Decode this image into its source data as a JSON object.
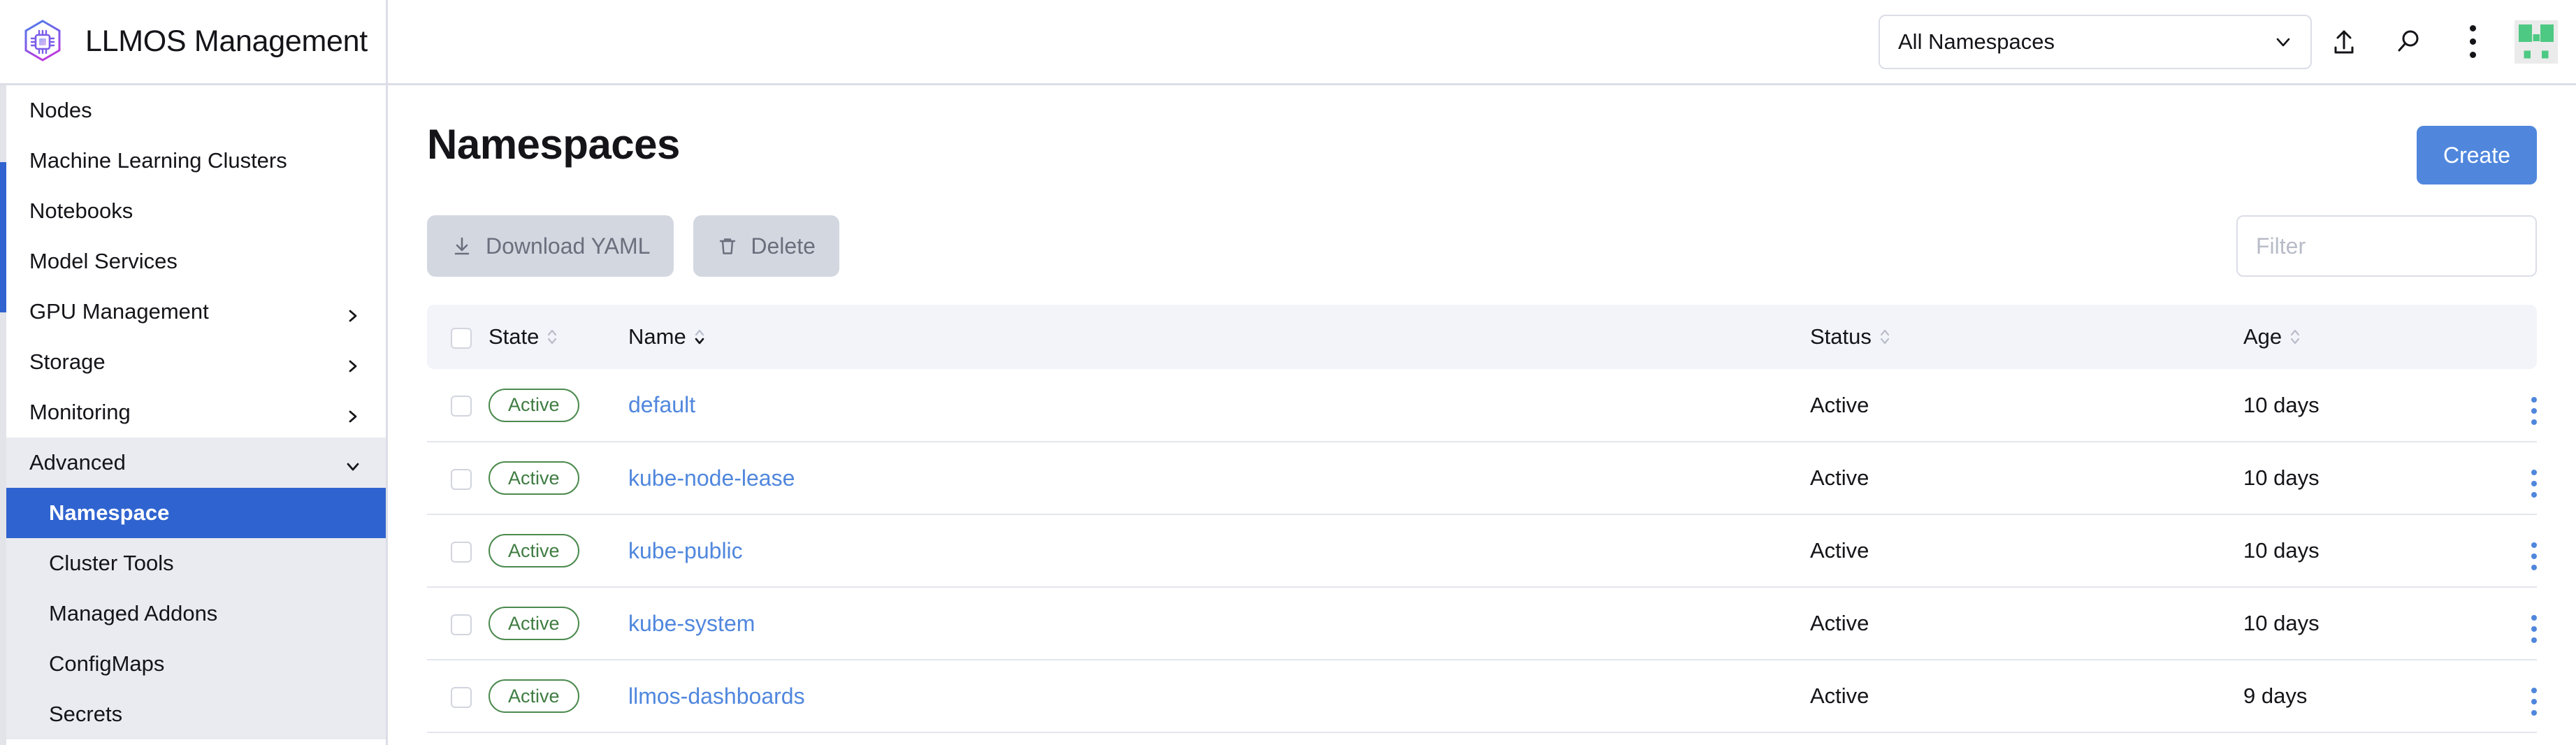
{
  "header": {
    "brand_title": "LLMOS Management",
    "logo_icon": "hexagon-chip-icon",
    "namespace_select": {
      "value": "All Namespaces",
      "chevron_icon": "chevron-down-icon"
    },
    "actions": [
      {
        "icon": "upload-icon",
        "name": "import-yaml-button"
      },
      {
        "icon": "search-icon",
        "name": "search-button"
      },
      {
        "icon": "kebab-menu-icon",
        "name": "header-overflow-menu"
      }
    ],
    "avatar_icon": "user-avatar-identicon"
  },
  "sidebar": {
    "items": [
      {
        "label": "Nodes",
        "type": "link",
        "chevron": ""
      },
      {
        "label": "Machine Learning Clusters",
        "type": "link",
        "chevron": ""
      },
      {
        "label": "Notebooks",
        "type": "link",
        "chevron": ""
      },
      {
        "label": "Model Services",
        "type": "link",
        "chevron": ""
      },
      {
        "label": "GPU Management",
        "type": "group",
        "chevron": "chevron-right-icon"
      },
      {
        "label": "Storage",
        "type": "group",
        "chevron": "chevron-right-icon"
      },
      {
        "label": "Monitoring",
        "type": "group",
        "chevron": "chevron-right-icon"
      },
      {
        "label": "Advanced",
        "type": "group-open",
        "chevron": "chevron-down-icon"
      },
      {
        "label": "Namespace",
        "type": "child-active",
        "chevron": ""
      },
      {
        "label": "Cluster Tools",
        "type": "child",
        "chevron": ""
      },
      {
        "label": "Managed Addons",
        "type": "child",
        "chevron": ""
      },
      {
        "label": "ConfigMaps",
        "type": "child",
        "chevron": ""
      },
      {
        "label": "Secrets",
        "type": "child",
        "chevron": ""
      }
    ]
  },
  "main": {
    "page_title": "Namespaces",
    "create_label": "Create",
    "toolbar": {
      "download_yaml_label": "Download YAML",
      "download_yaml_icon": "download-icon",
      "delete_label": "Delete",
      "delete_icon": "trash-icon",
      "filter_placeholder": "Filter",
      "filter_value": ""
    },
    "table": {
      "columns": [
        {
          "key": "check",
          "label": "",
          "sortable": false
        },
        {
          "key": "state",
          "label": "State",
          "sortable": true,
          "sort_active": false
        },
        {
          "key": "name",
          "label": "Name",
          "sortable": true,
          "sort_active": true
        },
        {
          "key": "status",
          "label": "Status",
          "sortable": true,
          "sort_active": false
        },
        {
          "key": "age",
          "label": "Age",
          "sortable": true,
          "sort_active": false
        },
        {
          "key": "menu",
          "label": "",
          "sortable": false
        }
      ],
      "rows": [
        {
          "state": "Active",
          "name": "default",
          "status": "Active",
          "age": "10 days"
        },
        {
          "state": "Active",
          "name": "kube-node-lease",
          "status": "Active",
          "age": "10 days"
        },
        {
          "state": "Active",
          "name": "kube-public",
          "status": "Active",
          "age": "10 days"
        },
        {
          "state": "Active",
          "name": "kube-system",
          "status": "Active",
          "age": "10 days"
        },
        {
          "state": "Active",
          "name": "llmos-dashboards",
          "status": "Active",
          "age": "9 days"
        }
      ]
    }
  },
  "colors": {
    "accent_blue": "#5087dd",
    "active_nav_blue": "#2f63cf",
    "badge_green": "#3f7c42",
    "header_row_bg": "#f2f4f9",
    "disabled_btn_bg": "#d3d7e0"
  }
}
